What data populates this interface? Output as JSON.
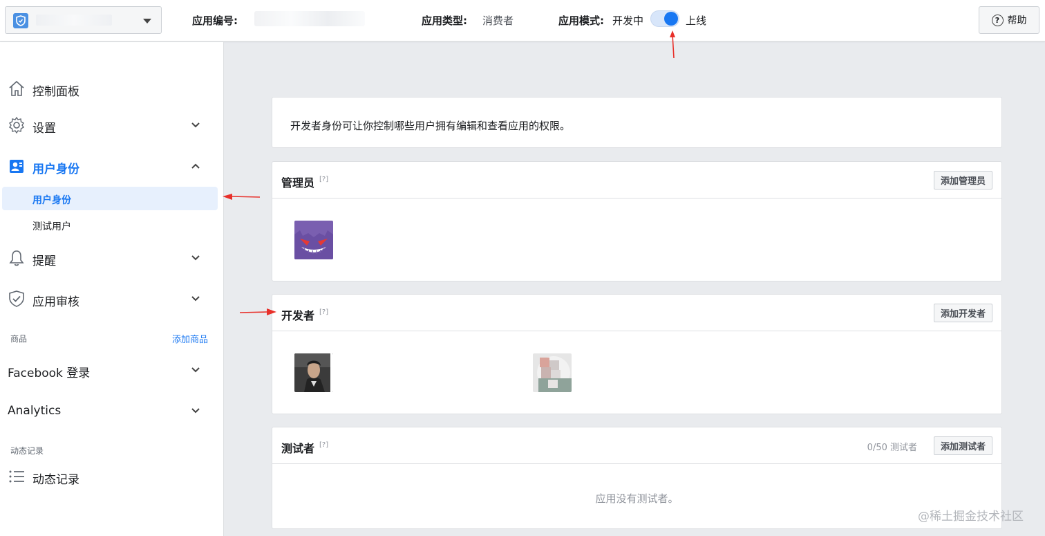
{
  "topbar": {
    "app_id_label": "应用编号:",
    "app_type_label": "应用类型:",
    "app_type_value": "消费者",
    "app_mode_label": "应用模式:",
    "app_mode_dev": "开发中",
    "app_mode_live": "上线",
    "help_label": "帮助"
  },
  "sidebar": {
    "items": [
      {
        "label": "控制面板",
        "icon": "home-icon"
      },
      {
        "label": "设置",
        "icon": "gear-icon"
      },
      {
        "label": "用户身份",
        "icon": "user-badge-icon"
      },
      {
        "label": "提醒",
        "icon": "bell-icon"
      },
      {
        "label": "应用审核",
        "icon": "shield-check-icon"
      }
    ],
    "sub_items": [
      {
        "label": "用户身份"
      },
      {
        "label": "测试用户"
      }
    ],
    "products_header": "商品",
    "add_product_link": "添加商品",
    "product_items": [
      "Facebook 登录",
      "Analytics"
    ],
    "activity_header": "动态记录",
    "activity_item": "动态记录"
  },
  "main": {
    "intro": "开发者身份可让你控制哪些用户拥有编辑和查看应用的权限。",
    "admins": {
      "title": "管理员",
      "hint": "[?]",
      "button": "添加管理员"
    },
    "developers": {
      "title": "开发者",
      "hint": "[?]",
      "button": "添加开发者"
    },
    "testers": {
      "title": "测试者",
      "hint": "[?]",
      "count": "0/50 测试者",
      "button": "添加测试者",
      "empty": "应用没有测试者。"
    }
  },
  "watermark": "@稀土掘金技术社区",
  "colors": {
    "accent": "#1877f2",
    "arrow": "#e8302a"
  }
}
